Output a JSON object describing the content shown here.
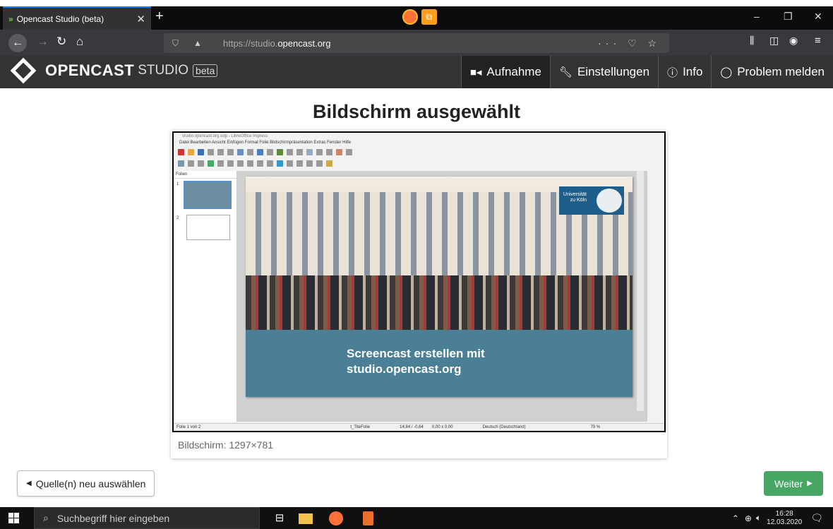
{
  "browser": {
    "tab_title": "Opencast Studio (beta)",
    "url_prefix": "https://studio.",
    "url_domain": "opencast.org",
    "new_tab": "+",
    "win_min": "–",
    "win_max": "❐",
    "win_close": "✕"
  },
  "app": {
    "logo_text": "OPENCAST",
    "logo_sub": "STUDIO",
    "logo_badge": "beta",
    "nav": [
      {
        "label": "Aufnahme",
        "icon": "video-icon"
      },
      {
        "label": "Einstellungen",
        "icon": "wrench-icon"
      },
      {
        "label": "Info",
        "icon": "info-icon"
      },
      {
        "label": "Problem melden",
        "icon": "github-icon"
      }
    ]
  },
  "main": {
    "heading": "Bildschirm ausgewählt",
    "caption": "Bildschirm: 1297×781",
    "back_button": "Quelle(n) neu auswählen",
    "next_button": "Weiter"
  },
  "preview": {
    "window_title": "studio.opencast.org.odp - LibreOffice Impress",
    "menu": "Datei  Bearbeiten  Ansicht  Einfügen  Format  Folie  Bildschirmpräsentation  Extras  Fenster  Hilfe",
    "panel_title": "Folien",
    "slide_line1": "Screencast erstellen mit",
    "slide_line2": "studio.opencast.org",
    "uni_logo": "Universität zu Köln",
    "status_slide": "Folie 1 von 2",
    "status_layout": "t_TiteFolie",
    "status_pos": "14,84 / -0,64",
    "status_size": "0,00 x 0,00",
    "status_lang": "Deutsch (Deutschland)",
    "status_zoom": "79 %",
    "thumb1_num": "1",
    "thumb2_num": "2"
  },
  "taskbar": {
    "search_placeholder": "Suchbegriff hier eingeben",
    "time": "16:28",
    "date": "12.03.2020"
  }
}
